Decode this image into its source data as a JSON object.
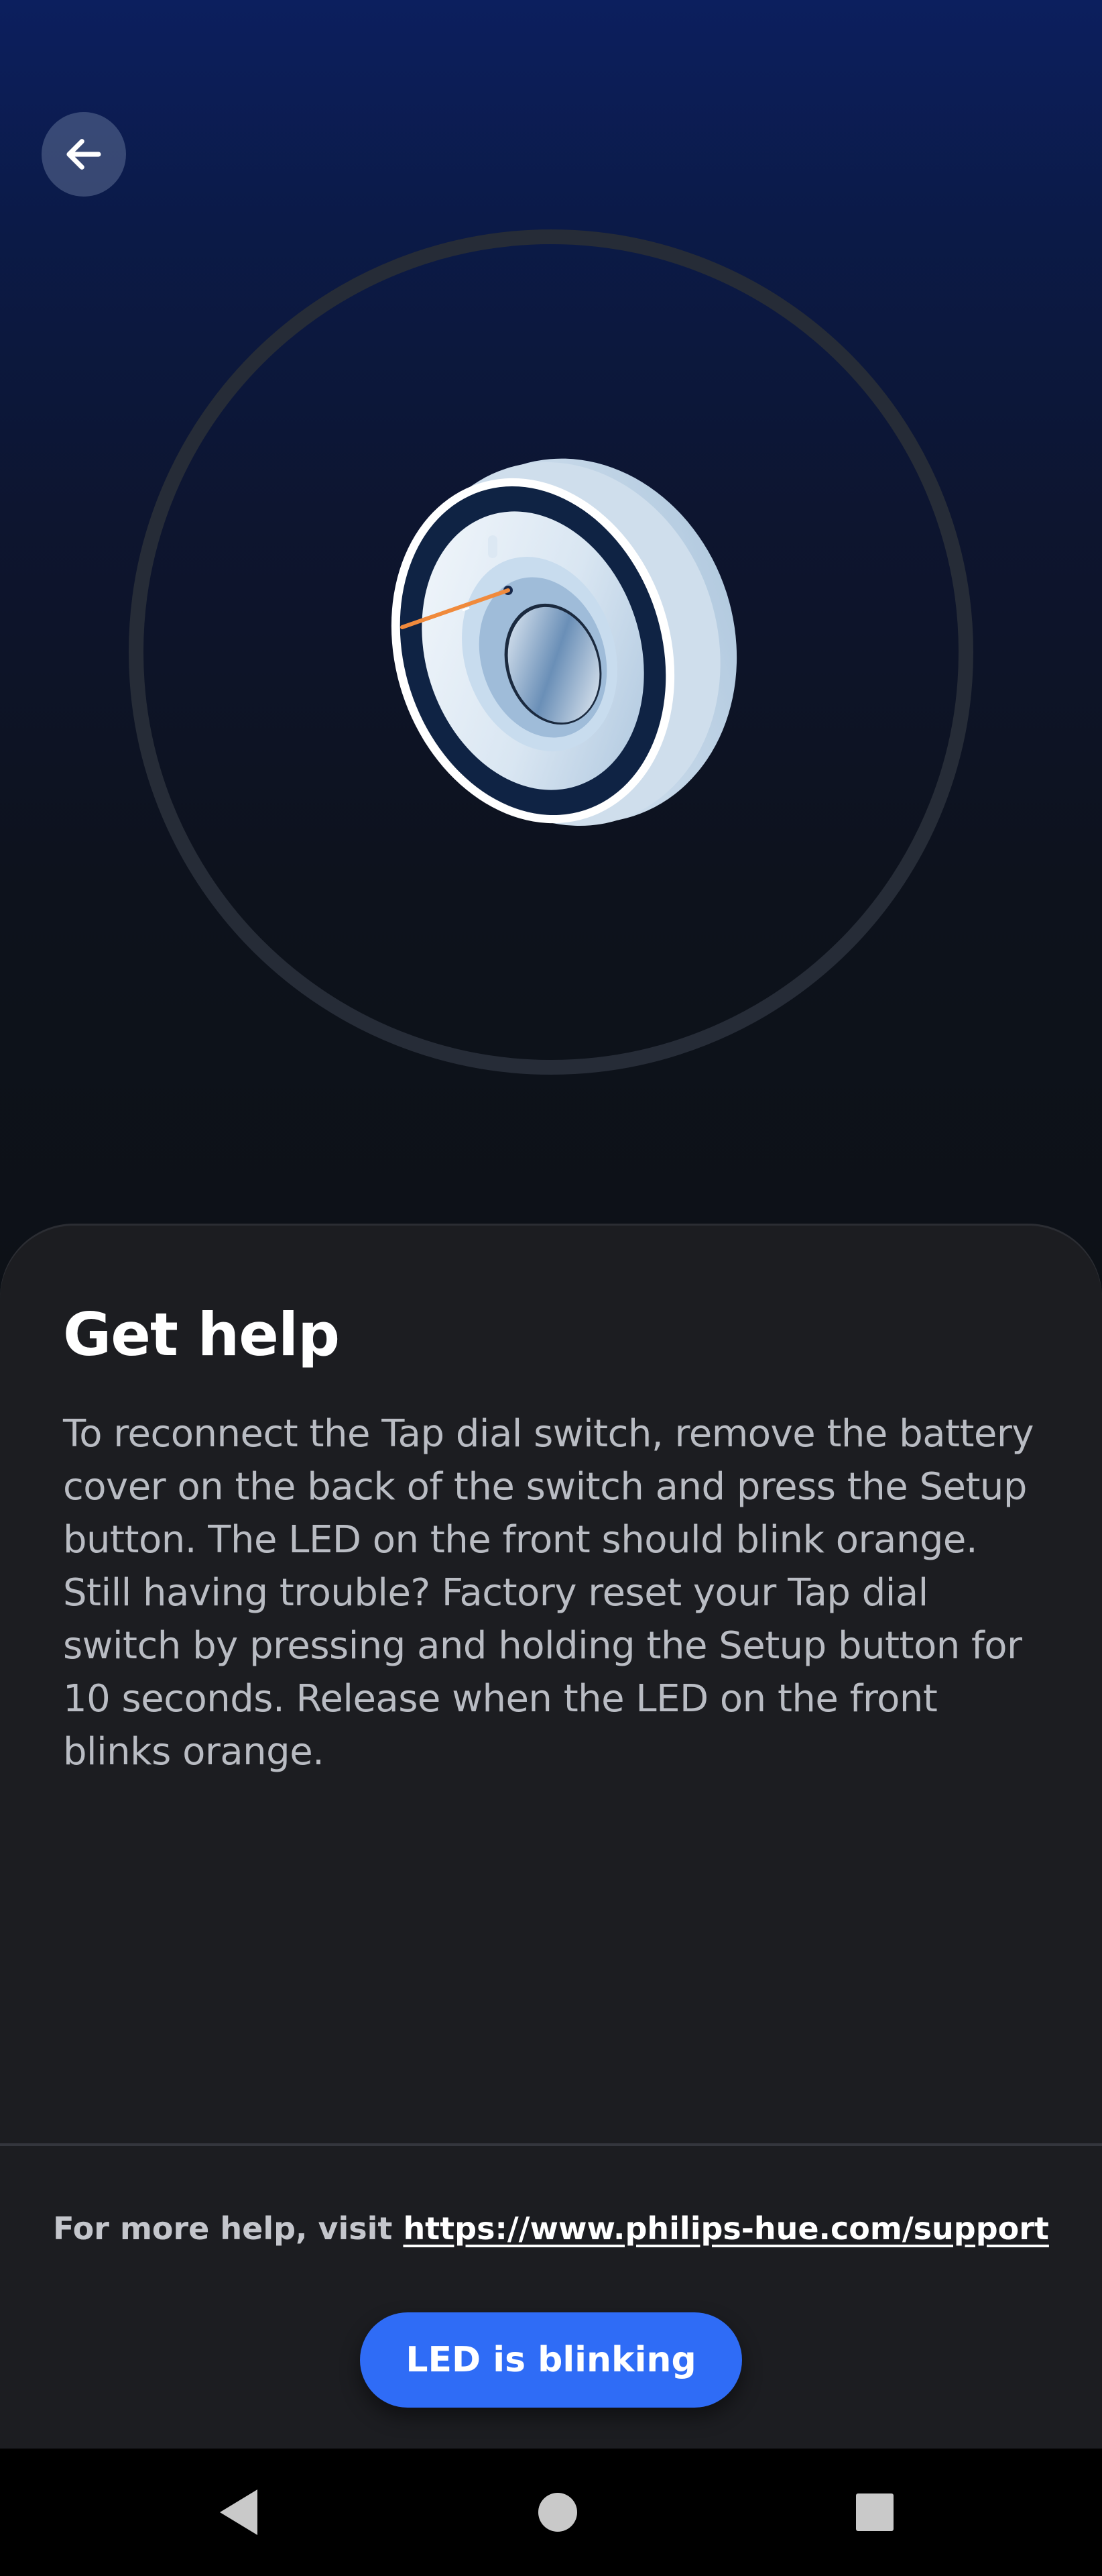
{
  "header": {
    "back_icon": "arrow-left-icon"
  },
  "illustration": {
    "device_icon": "tap-dial-switch-illustration",
    "led_color": "#f08a3c"
  },
  "content": {
    "title": "Get help",
    "paragraph_1": "To reconnect the Tap dial switch, remove the battery cover on the back of the switch and press the Setup button. The LED on the front should blink orange.",
    "paragraph_2": "Still having trouble? Factory reset your Tap dial switch by pressing and holding the Setup button for 10 seconds. Release when the LED on the front blinks orange."
  },
  "footer": {
    "help_prefix": "For more help, visit",
    "help_link": "https://www.philips-hue.com/support",
    "primary_button": "LED is blinking"
  },
  "system_nav": {
    "back_icon": "nav-back-triangle-icon",
    "home_icon": "nav-home-circle-icon",
    "recents_icon": "nav-recents-square-icon"
  },
  "colors": {
    "accent": "#2f6cf6",
    "sheet_background": "#1c1d21",
    "hero_top": "#0c1f5e"
  }
}
